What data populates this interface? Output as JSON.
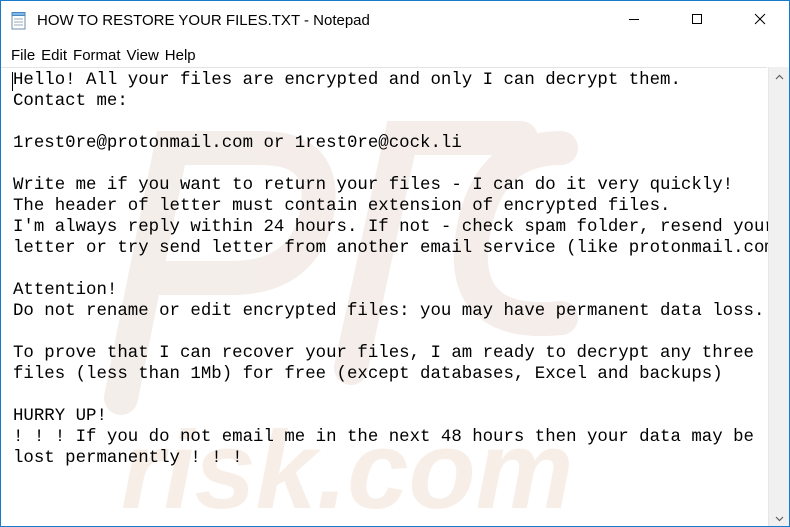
{
  "window": {
    "title": "HOW TO RESTORE YOUR FILES.TXT - Notepad",
    "accent_color": "#1979ca"
  },
  "menu": [
    {
      "label": "File"
    },
    {
      "label": "Edit"
    },
    {
      "label": "Format"
    },
    {
      "label": "View"
    },
    {
      "label": "Help"
    }
  ],
  "document": {
    "content": "Hello! All your files are encrypted and only I can decrypt them.\nContact me:\n\n1rest0re@protonmail.com or 1rest0re@cock.li\n\nWrite me if you want to return your files - I can do it very quickly!\nThe header of letter must contain extension of encrypted files.\nI'm always reply within 24 hours. If not - check spam folder, resend your\nletter or try send letter from another email service (like protonmail.com).\n\nAttention!\nDo not rename or edit encrypted files: you may have permanent data loss.\n\nTo prove that I can recover your files, I am ready to decrypt any three\nfiles (less than 1Mb) for free (except databases, Excel and backups)\n\nHURRY UP!\n! ! ! If you do not email me in the next 48 hours then your data may be\nlost permanently ! ! !"
  },
  "watermark": {
    "text": "risk.com"
  },
  "icons": {
    "app": "notepad-icon",
    "minimize": "minimize-icon",
    "maximize": "maximize-icon",
    "close": "close-icon",
    "scroll_up": "chevron-up-icon",
    "scroll_down": "chevron-down-icon"
  }
}
